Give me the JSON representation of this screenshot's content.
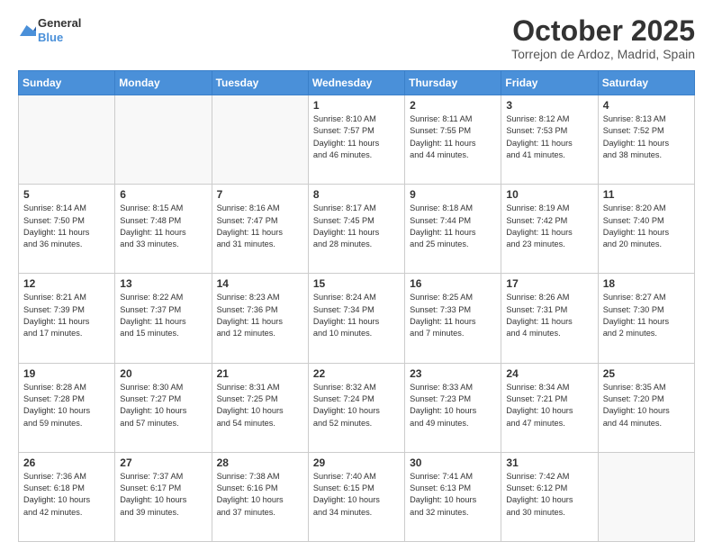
{
  "header": {
    "logo": {
      "line1": "General",
      "line2": "Blue"
    },
    "title": "October 2025",
    "subtitle": "Torrejon de Ardoz, Madrid, Spain"
  },
  "weekdays": [
    "Sunday",
    "Monday",
    "Tuesday",
    "Wednesday",
    "Thursday",
    "Friday",
    "Saturday"
  ],
  "weeks": [
    [
      {
        "day": "",
        "info": ""
      },
      {
        "day": "",
        "info": ""
      },
      {
        "day": "",
        "info": ""
      },
      {
        "day": "1",
        "info": "Sunrise: 8:10 AM\nSunset: 7:57 PM\nDaylight: 11 hours\nand 46 minutes."
      },
      {
        "day": "2",
        "info": "Sunrise: 8:11 AM\nSunset: 7:55 PM\nDaylight: 11 hours\nand 44 minutes."
      },
      {
        "day": "3",
        "info": "Sunrise: 8:12 AM\nSunset: 7:53 PM\nDaylight: 11 hours\nand 41 minutes."
      },
      {
        "day": "4",
        "info": "Sunrise: 8:13 AM\nSunset: 7:52 PM\nDaylight: 11 hours\nand 38 minutes."
      }
    ],
    [
      {
        "day": "5",
        "info": "Sunrise: 8:14 AM\nSunset: 7:50 PM\nDaylight: 11 hours\nand 36 minutes."
      },
      {
        "day": "6",
        "info": "Sunrise: 8:15 AM\nSunset: 7:48 PM\nDaylight: 11 hours\nand 33 minutes."
      },
      {
        "day": "7",
        "info": "Sunrise: 8:16 AM\nSunset: 7:47 PM\nDaylight: 11 hours\nand 31 minutes."
      },
      {
        "day": "8",
        "info": "Sunrise: 8:17 AM\nSunset: 7:45 PM\nDaylight: 11 hours\nand 28 minutes."
      },
      {
        "day": "9",
        "info": "Sunrise: 8:18 AM\nSunset: 7:44 PM\nDaylight: 11 hours\nand 25 minutes."
      },
      {
        "day": "10",
        "info": "Sunrise: 8:19 AM\nSunset: 7:42 PM\nDaylight: 11 hours\nand 23 minutes."
      },
      {
        "day": "11",
        "info": "Sunrise: 8:20 AM\nSunset: 7:40 PM\nDaylight: 11 hours\nand 20 minutes."
      }
    ],
    [
      {
        "day": "12",
        "info": "Sunrise: 8:21 AM\nSunset: 7:39 PM\nDaylight: 11 hours\nand 17 minutes."
      },
      {
        "day": "13",
        "info": "Sunrise: 8:22 AM\nSunset: 7:37 PM\nDaylight: 11 hours\nand 15 minutes."
      },
      {
        "day": "14",
        "info": "Sunrise: 8:23 AM\nSunset: 7:36 PM\nDaylight: 11 hours\nand 12 minutes."
      },
      {
        "day": "15",
        "info": "Sunrise: 8:24 AM\nSunset: 7:34 PM\nDaylight: 11 hours\nand 10 minutes."
      },
      {
        "day": "16",
        "info": "Sunrise: 8:25 AM\nSunset: 7:33 PM\nDaylight: 11 hours\nand 7 minutes."
      },
      {
        "day": "17",
        "info": "Sunrise: 8:26 AM\nSunset: 7:31 PM\nDaylight: 11 hours\nand 4 minutes."
      },
      {
        "day": "18",
        "info": "Sunrise: 8:27 AM\nSunset: 7:30 PM\nDaylight: 11 hours\nand 2 minutes."
      }
    ],
    [
      {
        "day": "19",
        "info": "Sunrise: 8:28 AM\nSunset: 7:28 PM\nDaylight: 10 hours\nand 59 minutes."
      },
      {
        "day": "20",
        "info": "Sunrise: 8:30 AM\nSunset: 7:27 PM\nDaylight: 10 hours\nand 57 minutes."
      },
      {
        "day": "21",
        "info": "Sunrise: 8:31 AM\nSunset: 7:25 PM\nDaylight: 10 hours\nand 54 minutes."
      },
      {
        "day": "22",
        "info": "Sunrise: 8:32 AM\nSunset: 7:24 PM\nDaylight: 10 hours\nand 52 minutes."
      },
      {
        "day": "23",
        "info": "Sunrise: 8:33 AM\nSunset: 7:23 PM\nDaylight: 10 hours\nand 49 minutes."
      },
      {
        "day": "24",
        "info": "Sunrise: 8:34 AM\nSunset: 7:21 PM\nDaylight: 10 hours\nand 47 minutes."
      },
      {
        "day": "25",
        "info": "Sunrise: 8:35 AM\nSunset: 7:20 PM\nDaylight: 10 hours\nand 44 minutes."
      }
    ],
    [
      {
        "day": "26",
        "info": "Sunrise: 7:36 AM\nSunset: 6:18 PM\nDaylight: 10 hours\nand 42 minutes."
      },
      {
        "day": "27",
        "info": "Sunrise: 7:37 AM\nSunset: 6:17 PM\nDaylight: 10 hours\nand 39 minutes."
      },
      {
        "day": "28",
        "info": "Sunrise: 7:38 AM\nSunset: 6:16 PM\nDaylight: 10 hours\nand 37 minutes."
      },
      {
        "day": "29",
        "info": "Sunrise: 7:40 AM\nSunset: 6:15 PM\nDaylight: 10 hours\nand 34 minutes."
      },
      {
        "day": "30",
        "info": "Sunrise: 7:41 AM\nSunset: 6:13 PM\nDaylight: 10 hours\nand 32 minutes."
      },
      {
        "day": "31",
        "info": "Sunrise: 7:42 AM\nSunset: 6:12 PM\nDaylight: 10 hours\nand 30 minutes."
      },
      {
        "day": "",
        "info": ""
      }
    ]
  ]
}
